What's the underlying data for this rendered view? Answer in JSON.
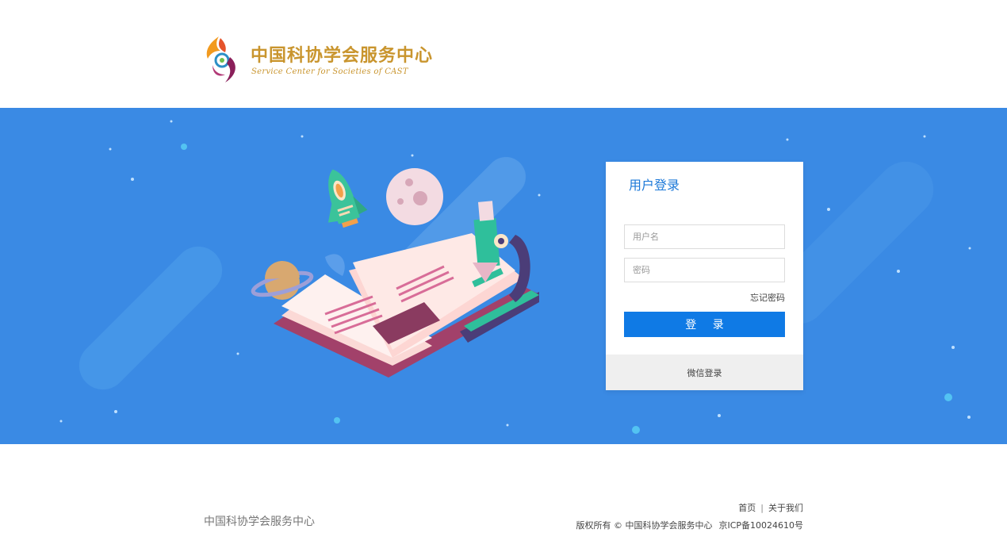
{
  "header": {
    "logo_cn": "中国科协学会服务中心",
    "logo_en": "Service Center for Societies of CAST"
  },
  "login": {
    "title": "用户登录",
    "username_placeholder": "用户名",
    "password_placeholder": "密码",
    "forgot_password": "忘记密码",
    "submit_label": "登 录",
    "wechat_login": "微信登录"
  },
  "footer": {
    "brand": "中国科协学会服务中心",
    "links": [
      {
        "label": "首页"
      },
      {
        "label": "关于我们"
      }
    ],
    "separator": "|",
    "copyright": "版权所有 © 中国科协学会服务中心",
    "icp": "京ICP备10024610号"
  },
  "colors": {
    "banner": "#3a8ae4",
    "primary_button": "#0f7ae5",
    "title_blue": "#1b78d8",
    "logo_gold": "#c9952e"
  },
  "icons": [
    "cast-logo-icon",
    "rocket-icon",
    "moon-icon",
    "planet-icon",
    "open-book-icon",
    "microscope-icon"
  ]
}
